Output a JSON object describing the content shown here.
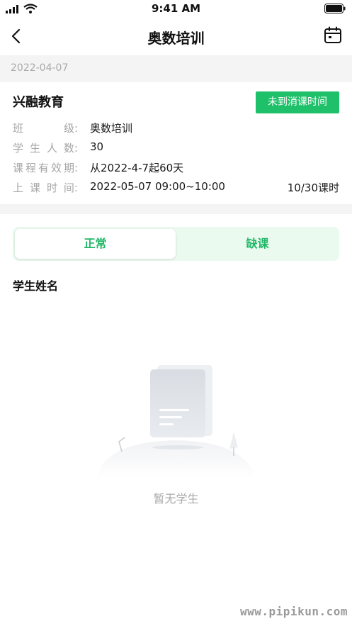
{
  "status_bar": {
    "time": "9:41 AM",
    "icons": [
      "signal-icon",
      "wifi-icon",
      "battery-icon"
    ]
  },
  "nav": {
    "title": "奥数培训",
    "back_icon": "chevron-left-icon",
    "calendar_icon": "calendar-icon"
  },
  "date": "2022-04-07",
  "course": {
    "org_name": "兴融教育",
    "status_button": "未到消课时间",
    "class_label_chars": [
      "班",
      "级:"
    ],
    "class_value": "奥数培训",
    "students_label_chars": [
      "学",
      "生",
      "人",
      "数:"
    ],
    "students_value": "30",
    "validity_label_chars": [
      "课",
      "程",
      "有",
      "效",
      "期:"
    ],
    "validity_value": "从2022-4-7起60天",
    "time_label_chars": [
      "上",
      "课",
      "时",
      "间:"
    ],
    "time_value": "2022-05-07 09:00~10:00",
    "hours_value": "10/30课时"
  },
  "tabs": {
    "normal": "正常",
    "absent": "缺课",
    "active": "normal"
  },
  "section_title": "学生姓名",
  "empty_state": {
    "text": "暂无学生"
  },
  "watermark": "www.pipikun.com",
  "colors": {
    "accent": "#1fc06a",
    "tab_bg": "#eafaee",
    "muted": "#a6a6a6",
    "strip": "#f4f4f4"
  }
}
